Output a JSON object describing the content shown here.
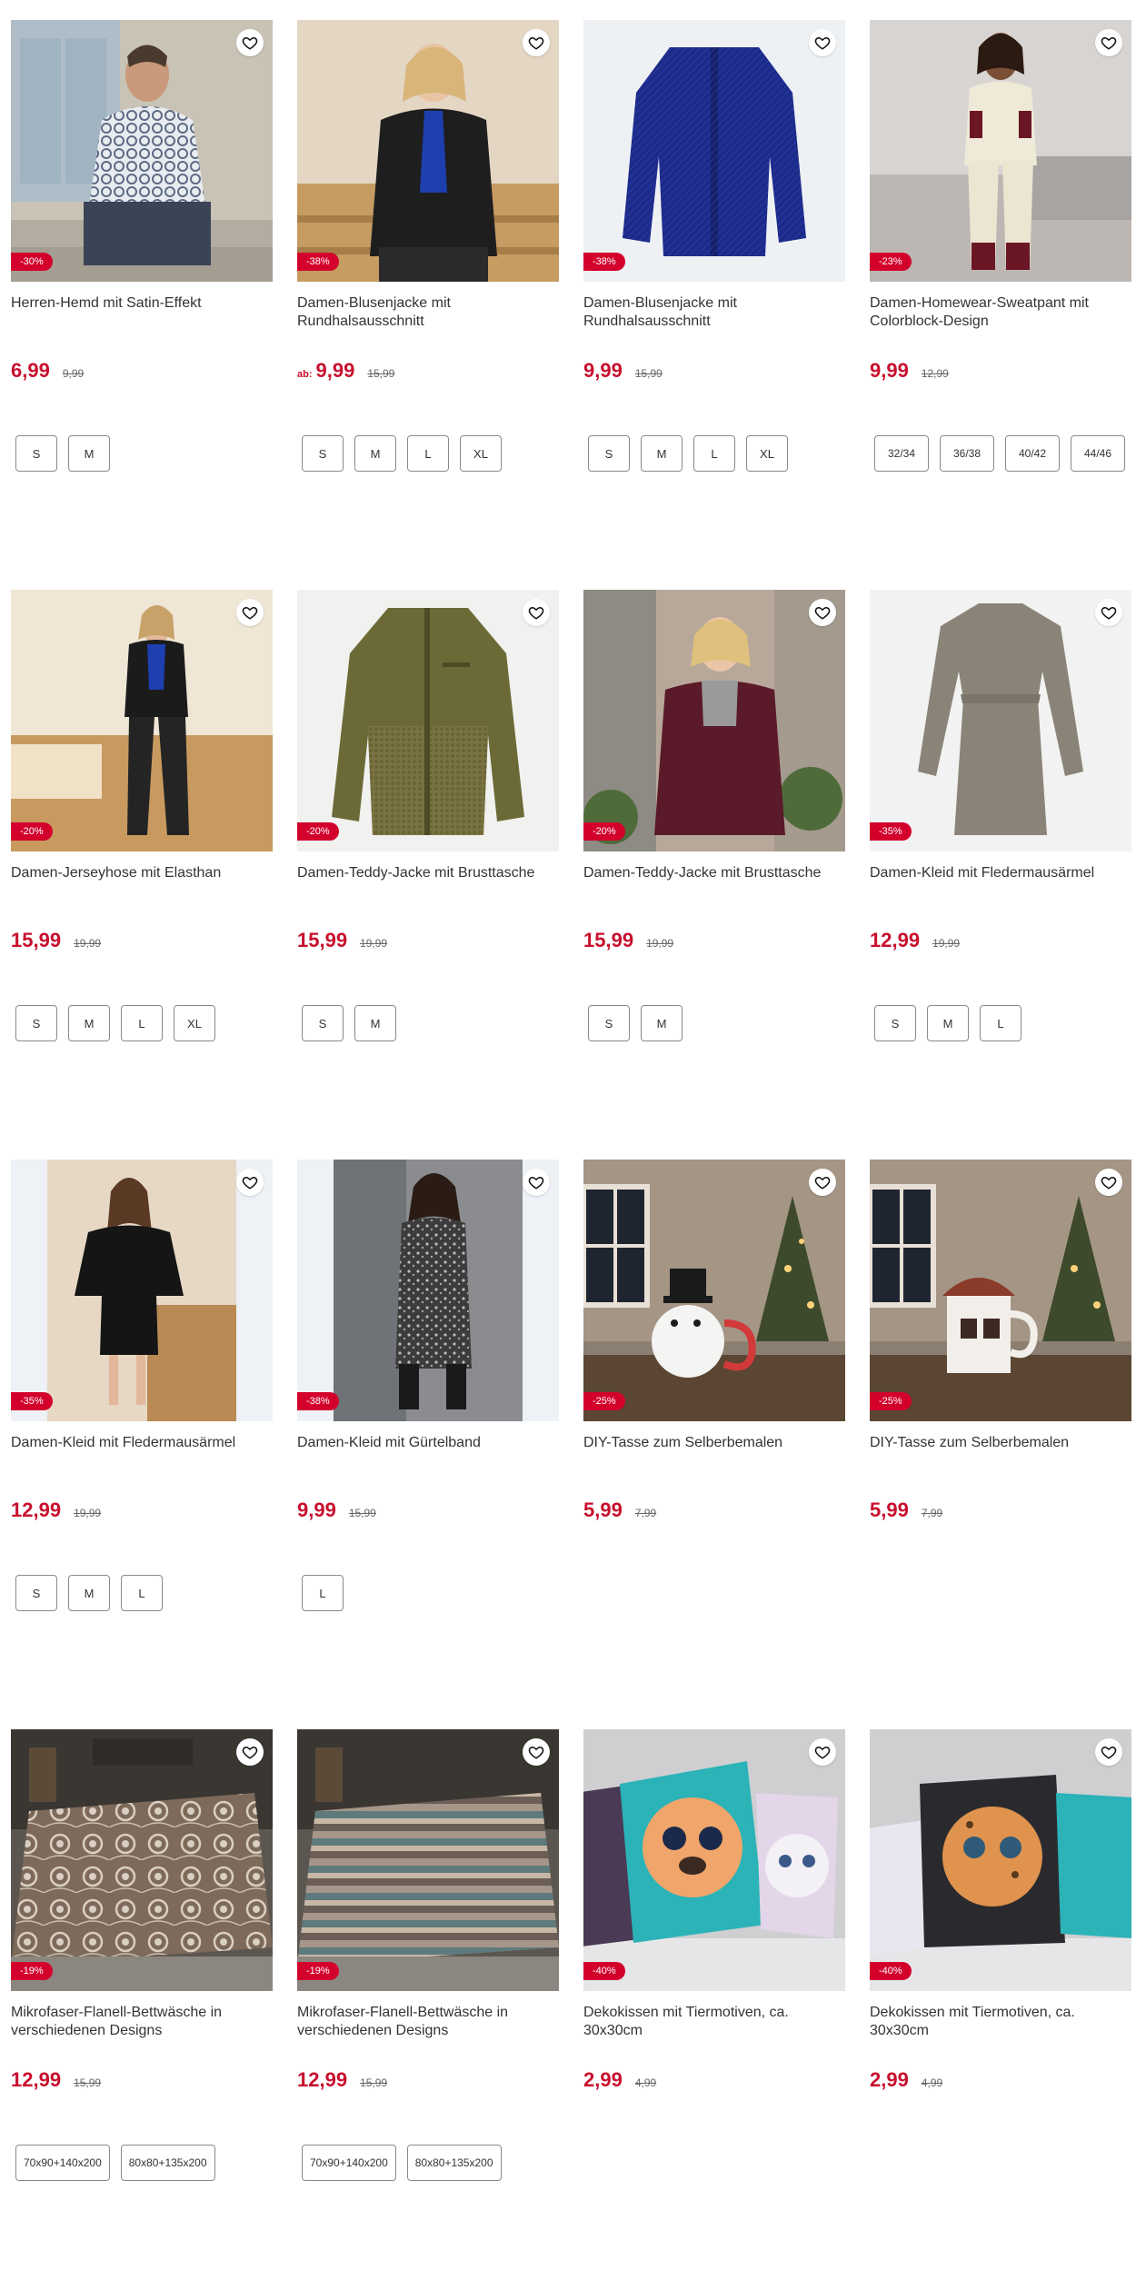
{
  "products": [
    {
      "title": "Herren-Hemd mit Satin-Effekt",
      "badge": "-30%",
      "prefix": "",
      "price": "6,99",
      "old_price": "9,99",
      "sizes": [
        "S",
        "M"
      ],
      "image": "man-shirt-photo"
    },
    {
      "title": "Damen-Blusenjacke mit Rundhalsausschnitt",
      "badge": "-38%",
      "prefix": "ab:",
      "price": "9,99",
      "old_price": "15,99",
      "sizes": [
        "S",
        "M",
        "L",
        "XL"
      ],
      "image": "woman-black-jacket-photo"
    },
    {
      "title": "Damen-Blusenjacke mit Rundhalsausschnitt",
      "badge": "-38%",
      "prefix": "",
      "price": "9,99",
      "old_price": "15,99",
      "sizes": [
        "S",
        "M",
        "L",
        "XL"
      ],
      "image": "blue-jacket-photo"
    },
    {
      "title": "Damen-Homewear-Sweatpant mit Colorblock-Design",
      "badge": "-23%",
      "prefix": "",
      "price": "9,99",
      "old_price": "12,99",
      "sizes": [
        "32/34",
        "36/38",
        "40/42",
        "44/46"
      ],
      "image": "woman-homewear-photo"
    },
    {
      "title": "Damen-Jerseyhose mit Elasthan",
      "badge": "-20%",
      "prefix": "",
      "price": "15,99",
      "old_price": "19,99",
      "sizes": [
        "S",
        "M",
        "L",
        "XL"
      ],
      "image": "woman-jersey-pants-photo"
    },
    {
      "title": "Damen-Teddy-Jacke mit Brusttasche",
      "badge": "-20%",
      "prefix": "",
      "price": "15,99",
      "old_price": "19,99",
      "sizes": [
        "S",
        "M"
      ],
      "image": "olive-teddy-jacket-photo"
    },
    {
      "title": "Damen-Teddy-Jacke mit Brusttasche",
      "badge": "-20%",
      "prefix": "",
      "price": "15,99",
      "old_price": "19,99",
      "sizes": [
        "S",
        "M"
      ],
      "image": "woman-burgundy-teddy-photo"
    },
    {
      "title": "Damen-Kleid mit Fledermausärmel",
      "badge": "-35%",
      "prefix": "",
      "price": "12,99",
      "old_price": "19,99",
      "sizes": [
        "S",
        "M",
        "L"
      ],
      "image": "grey-dress-photo"
    },
    {
      "title": "Damen-Kleid mit Fledermausärmel",
      "badge": "-35%",
      "prefix": "",
      "price": "12,99",
      "old_price": "19,99",
      "sizes": [
        "S",
        "M",
        "L"
      ],
      "image": "woman-black-dress-photo"
    },
    {
      "title": "Damen-Kleid mit Gürtelband",
      "badge": "-38%",
      "prefix": "",
      "price": "9,99",
      "old_price": "15,99",
      "sizes": [
        "L"
      ],
      "image": "woman-print-dress-photo"
    },
    {
      "title": "DIY-Tasse zum Selberbemalen",
      "badge": "-25%",
      "prefix": "",
      "price": "5,99",
      "old_price": "7,99",
      "sizes": [],
      "image": "snowman-mug-photo"
    },
    {
      "title": "DIY-Tasse zum Selberbemalen",
      "badge": "-25%",
      "prefix": "",
      "price": "5,99",
      "old_price": "7,99",
      "sizes": [],
      "image": "house-mug-photo"
    },
    {
      "title": "Mikrofaser-Flanell-Bettwäsche in verschiedenen Designs",
      "badge": "-19%",
      "prefix": "",
      "price": "12,99",
      "old_price": "15,99",
      "sizes": [
        "70x90+140x200",
        "80x80+135x200"
      ],
      "image": "floral-bedding-photo"
    },
    {
      "title": "Mikrofaser-Flanell-Bettwäsche in verschiedenen Designs",
      "badge": "-19%",
      "prefix": "",
      "price": "12,99",
      "old_price": "15,99",
      "sizes": [
        "70x90+140x200",
        "80x80+135x200"
      ],
      "image": "striped-bedding-photo"
    },
    {
      "title": "Dekokissen mit Tiermotiven, ca. 30x30cm",
      "badge": "-40%",
      "prefix": "",
      "price": "2,99",
      "old_price": "4,99",
      "sizes": [],
      "image": "animal-pillows-photo"
    },
    {
      "title": "Dekokissen mit Tiermotiven, ca. 30x30cm",
      "badge": "-40%",
      "prefix": "",
      "price": "2,99",
      "old_price": "4,99",
      "sizes": [],
      "image": "leopard-pillows-photo"
    }
  ],
  "colors": {
    "price": "#c8102e",
    "badge": "#d3002c"
  }
}
